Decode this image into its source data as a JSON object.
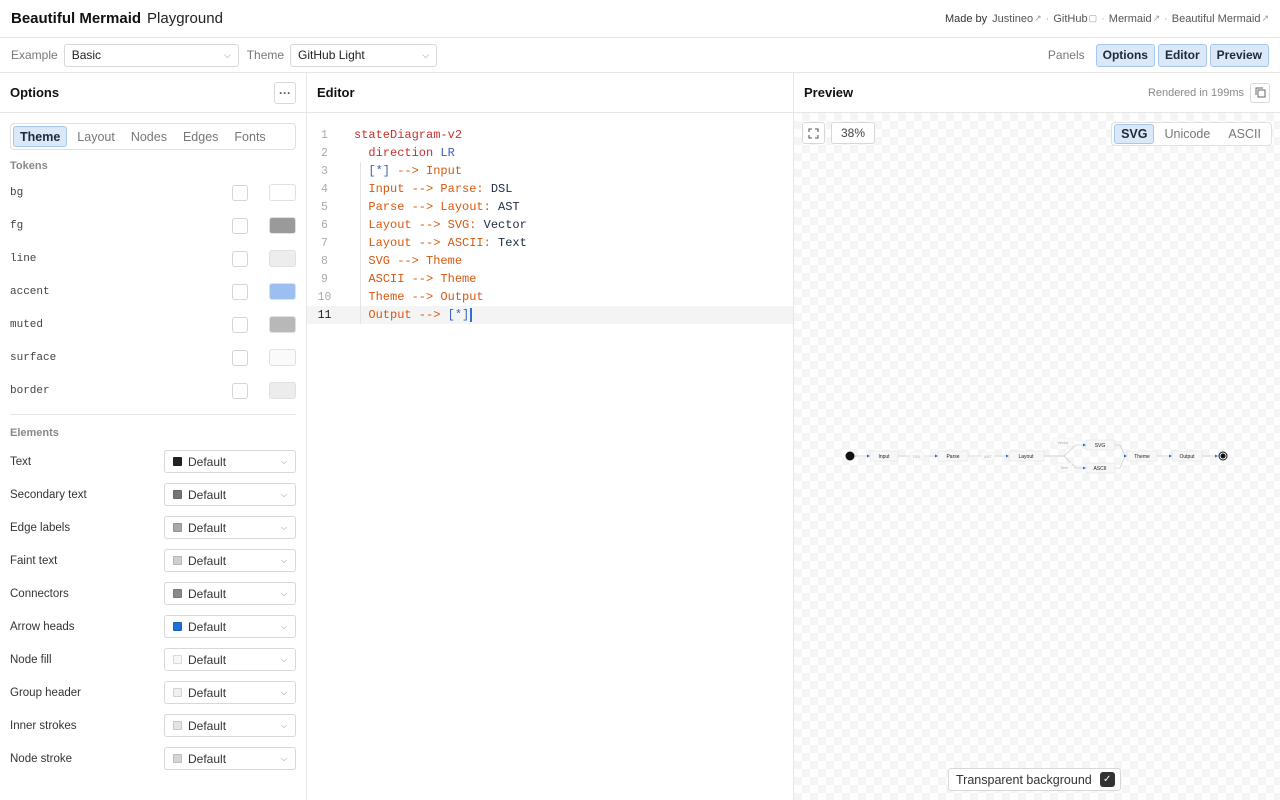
{
  "header": {
    "brand": "Beautiful Mermaid",
    "subtitle": "Playground",
    "made_by": "Made by",
    "links": [
      "Justineo",
      "GitHub",
      "Mermaid",
      "Beautiful Mermaid"
    ]
  },
  "toolbar": {
    "example_label": "Example",
    "example_value": "Basic",
    "theme_label": "Theme",
    "theme_value": "GitHub Light",
    "panels_label": "Panels",
    "panel_buttons": [
      "Options",
      "Editor",
      "Preview"
    ]
  },
  "options": {
    "title": "Options",
    "more_icon": "ellipsis-icon",
    "tabs": [
      "Theme",
      "Layout",
      "Nodes",
      "Edges",
      "Fonts"
    ],
    "active_tab": "Theme",
    "tokens_heading": "Tokens",
    "tokens": [
      {
        "name": "bg",
        "color": "#ffffff"
      },
      {
        "name": "fg",
        "color": "#9a9a9a"
      },
      {
        "name": "line",
        "color": "#ededed"
      },
      {
        "name": "accent",
        "color": "#9bbff0"
      },
      {
        "name": "muted",
        "color": "#b8b8b8"
      },
      {
        "name": "surface",
        "color": "#fafafa"
      },
      {
        "name": "border",
        "color": "#ececec"
      }
    ],
    "elements_heading": "Elements",
    "elements": [
      {
        "name": "Text",
        "value": "Default",
        "color": "#222222"
      },
      {
        "name": "Secondary text",
        "value": "Default",
        "color": "#777777"
      },
      {
        "name": "Edge labels",
        "value": "Default",
        "color": "#a8a8a8"
      },
      {
        "name": "Faint text",
        "value": "Default",
        "color": "#cfcfcf"
      },
      {
        "name": "Connectors",
        "value": "Default",
        "color": "#8a8a8a"
      },
      {
        "name": "Arrow heads",
        "value": "Default",
        "color": "#1f6fd6"
      },
      {
        "name": "Node fill",
        "value": "Default",
        "color": "#f7f7f7"
      },
      {
        "name": "Group header",
        "value": "Default",
        "color": "#f0f0f0"
      },
      {
        "name": "Inner strokes",
        "value": "Default",
        "color": "#e4e4e4"
      },
      {
        "name": "Node stroke",
        "value": "Default",
        "color": "#d6d6d6"
      }
    ]
  },
  "editor": {
    "title": "Editor",
    "current_line": 11,
    "lines": [
      {
        "n": "1",
        "tokens": [
          {
            "t": "stateDiagram-v2",
            "c": "kw"
          }
        ]
      },
      {
        "n": "2",
        "tokens": [
          {
            "t": "  direction ",
            "c": "kw"
          },
          {
            "t": "LR",
            "c": "bl"
          }
        ]
      },
      {
        "n": "3",
        "tokens": [
          {
            "t": "  [*]",
            "c": "bl"
          },
          {
            "t": " --> Input",
            "c": "or"
          }
        ]
      },
      {
        "n": "4",
        "tokens": [
          {
            "t": "  Input --> Parse:",
            "c": "or"
          },
          {
            "t": " DSL",
            "c": "dk"
          }
        ]
      },
      {
        "n": "5",
        "tokens": [
          {
            "t": "  Parse --> Layout:",
            "c": "or"
          },
          {
            "t": " AST",
            "c": "dk"
          }
        ]
      },
      {
        "n": "6",
        "tokens": [
          {
            "t": "  Layout --> SVG:",
            "c": "or"
          },
          {
            "t": " Vector",
            "c": "dk"
          }
        ]
      },
      {
        "n": "7",
        "tokens": [
          {
            "t": "  Layout --> ASCII:",
            "c": "or"
          },
          {
            "t": " Text",
            "c": "dk"
          }
        ]
      },
      {
        "n": "8",
        "tokens": [
          {
            "t": "  SVG --> Theme",
            "c": "or"
          }
        ]
      },
      {
        "n": "9",
        "tokens": [
          {
            "t": "  ASCII --> Theme",
            "c": "or"
          }
        ]
      },
      {
        "n": "10",
        "tokens": [
          {
            "t": "  Theme --> Output",
            "c": "or"
          }
        ]
      },
      {
        "n": "11",
        "tokens": [
          {
            "t": "  Output --> ",
            "c": "or"
          },
          {
            "t": "[*]",
            "c": "bl"
          }
        ]
      }
    ]
  },
  "preview": {
    "title": "Preview",
    "rendered": "Rendered in 199ms",
    "zoom": "38%",
    "modes": [
      "SVG",
      "Unicode",
      "ASCII"
    ],
    "active_mode": "SVG",
    "transparent_label": "Transparent background",
    "transparent_checked": true,
    "diagram": {
      "nodes": [
        "Input",
        "Parse",
        "Layout",
        "SVG",
        "ASCII",
        "Theme",
        "Output"
      ],
      "edge_labels": [
        "DSL",
        "AST",
        "Vector",
        "Text"
      ]
    }
  }
}
